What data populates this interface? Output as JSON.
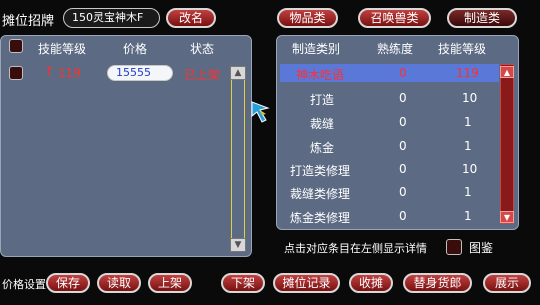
{
  "top": {
    "sign_label": "摊位招牌",
    "sign_value": "150灵宝神木F",
    "rename_btn": "改名",
    "tabs": [
      "物品类",
      "召唤兽类",
      "制造类"
    ]
  },
  "left": {
    "headers": [
      "技能等级",
      "价格",
      "状态"
    ],
    "row": {
      "arrow": "↑",
      "level": "119",
      "price": "15555",
      "status": "已上架"
    }
  },
  "right": {
    "headers": [
      "制造类别",
      "熟练度",
      "技能等级"
    ],
    "rows": [
      {
        "category": "神木吃语",
        "proficiency": "0",
        "level": "119"
      },
      {
        "category": "打造",
        "proficiency": "0",
        "level": "10"
      },
      {
        "category": "裁缝",
        "proficiency": "0",
        "level": "1"
      },
      {
        "category": "炼金",
        "proficiency": "0",
        "level": "1"
      },
      {
        "category": "打造类修理",
        "proficiency": "0",
        "level": "10"
      },
      {
        "category": "裁缝类修理",
        "proficiency": "0",
        "level": "1"
      },
      {
        "category": "炼金类修理",
        "proficiency": "0",
        "level": "1"
      }
    ],
    "hint": "点击对应条目在左侧显示详情",
    "tujian": "图鉴"
  },
  "bottom": {
    "label": "价格设置:",
    "buttons": [
      "保存",
      "读取",
      "上架",
      "下架",
      "摊位记录",
      "收摊",
      "替身货郎",
      "展示"
    ]
  },
  "colors": {
    "panel": "#5c6b83",
    "button_red": "#9a2020",
    "selected_row": "#5a78d8",
    "status_red": "#ff3030",
    "price_blue": "#1f3cc9"
  }
}
